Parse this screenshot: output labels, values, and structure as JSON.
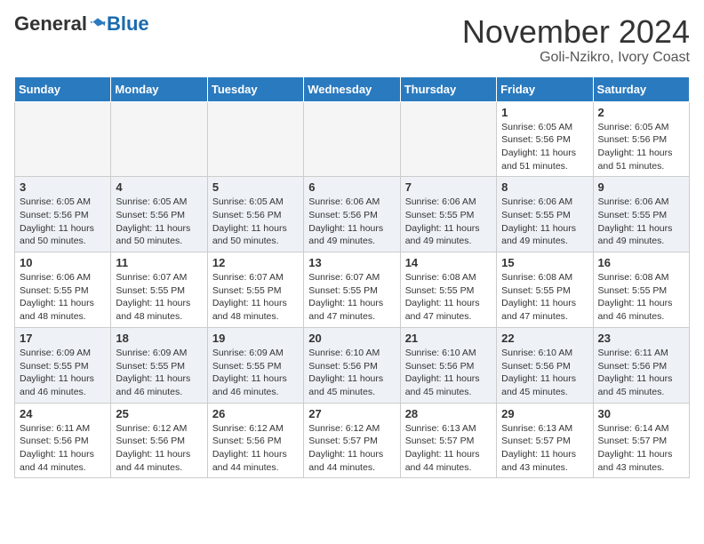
{
  "header": {
    "logo_general": "General",
    "logo_blue": "Blue",
    "month_title": "November 2024",
    "location": "Goli-Nzikro, Ivory Coast"
  },
  "calendar": {
    "days_of_week": [
      "Sunday",
      "Monday",
      "Tuesday",
      "Wednesday",
      "Thursday",
      "Friday",
      "Saturday"
    ],
    "weeks": [
      [
        {
          "day": "",
          "empty": true
        },
        {
          "day": "",
          "empty": true
        },
        {
          "day": "",
          "empty": true
        },
        {
          "day": "",
          "empty": true
        },
        {
          "day": "",
          "empty": true
        },
        {
          "day": "1",
          "sunrise": "Sunrise: 6:05 AM",
          "sunset": "Sunset: 5:56 PM",
          "daylight": "Daylight: 11 hours and 51 minutes."
        },
        {
          "day": "2",
          "sunrise": "Sunrise: 6:05 AM",
          "sunset": "Sunset: 5:56 PM",
          "daylight": "Daylight: 11 hours and 51 minutes."
        }
      ],
      [
        {
          "day": "3",
          "sunrise": "Sunrise: 6:05 AM",
          "sunset": "Sunset: 5:56 PM",
          "daylight": "Daylight: 11 hours and 50 minutes."
        },
        {
          "day": "4",
          "sunrise": "Sunrise: 6:05 AM",
          "sunset": "Sunset: 5:56 PM",
          "daylight": "Daylight: 11 hours and 50 minutes."
        },
        {
          "day": "5",
          "sunrise": "Sunrise: 6:05 AM",
          "sunset": "Sunset: 5:56 PM",
          "daylight": "Daylight: 11 hours and 50 minutes."
        },
        {
          "day": "6",
          "sunrise": "Sunrise: 6:06 AM",
          "sunset": "Sunset: 5:56 PM",
          "daylight": "Daylight: 11 hours and 49 minutes."
        },
        {
          "day": "7",
          "sunrise": "Sunrise: 6:06 AM",
          "sunset": "Sunset: 5:55 PM",
          "daylight": "Daylight: 11 hours and 49 minutes."
        },
        {
          "day": "8",
          "sunrise": "Sunrise: 6:06 AM",
          "sunset": "Sunset: 5:55 PM",
          "daylight": "Daylight: 11 hours and 49 minutes."
        },
        {
          "day": "9",
          "sunrise": "Sunrise: 6:06 AM",
          "sunset": "Sunset: 5:55 PM",
          "daylight": "Daylight: 11 hours and 49 minutes."
        }
      ],
      [
        {
          "day": "10",
          "sunrise": "Sunrise: 6:06 AM",
          "sunset": "Sunset: 5:55 PM",
          "daylight": "Daylight: 11 hours and 48 minutes."
        },
        {
          "day": "11",
          "sunrise": "Sunrise: 6:07 AM",
          "sunset": "Sunset: 5:55 PM",
          "daylight": "Daylight: 11 hours and 48 minutes."
        },
        {
          "day": "12",
          "sunrise": "Sunrise: 6:07 AM",
          "sunset": "Sunset: 5:55 PM",
          "daylight": "Daylight: 11 hours and 48 minutes."
        },
        {
          "day": "13",
          "sunrise": "Sunrise: 6:07 AM",
          "sunset": "Sunset: 5:55 PM",
          "daylight": "Daylight: 11 hours and 47 minutes."
        },
        {
          "day": "14",
          "sunrise": "Sunrise: 6:08 AM",
          "sunset": "Sunset: 5:55 PM",
          "daylight": "Daylight: 11 hours and 47 minutes."
        },
        {
          "day": "15",
          "sunrise": "Sunrise: 6:08 AM",
          "sunset": "Sunset: 5:55 PM",
          "daylight": "Daylight: 11 hours and 47 minutes."
        },
        {
          "day": "16",
          "sunrise": "Sunrise: 6:08 AM",
          "sunset": "Sunset: 5:55 PM",
          "daylight": "Daylight: 11 hours and 46 minutes."
        }
      ],
      [
        {
          "day": "17",
          "sunrise": "Sunrise: 6:09 AM",
          "sunset": "Sunset: 5:55 PM",
          "daylight": "Daylight: 11 hours and 46 minutes."
        },
        {
          "day": "18",
          "sunrise": "Sunrise: 6:09 AM",
          "sunset": "Sunset: 5:55 PM",
          "daylight": "Daylight: 11 hours and 46 minutes."
        },
        {
          "day": "19",
          "sunrise": "Sunrise: 6:09 AM",
          "sunset": "Sunset: 5:55 PM",
          "daylight": "Daylight: 11 hours and 46 minutes."
        },
        {
          "day": "20",
          "sunrise": "Sunrise: 6:10 AM",
          "sunset": "Sunset: 5:56 PM",
          "daylight": "Daylight: 11 hours and 45 minutes."
        },
        {
          "day": "21",
          "sunrise": "Sunrise: 6:10 AM",
          "sunset": "Sunset: 5:56 PM",
          "daylight": "Daylight: 11 hours and 45 minutes."
        },
        {
          "day": "22",
          "sunrise": "Sunrise: 6:10 AM",
          "sunset": "Sunset: 5:56 PM",
          "daylight": "Daylight: 11 hours and 45 minutes."
        },
        {
          "day": "23",
          "sunrise": "Sunrise: 6:11 AM",
          "sunset": "Sunset: 5:56 PM",
          "daylight": "Daylight: 11 hours and 45 minutes."
        }
      ],
      [
        {
          "day": "24",
          "sunrise": "Sunrise: 6:11 AM",
          "sunset": "Sunset: 5:56 PM",
          "daylight": "Daylight: 11 hours and 44 minutes."
        },
        {
          "day": "25",
          "sunrise": "Sunrise: 6:12 AM",
          "sunset": "Sunset: 5:56 PM",
          "daylight": "Daylight: 11 hours and 44 minutes."
        },
        {
          "day": "26",
          "sunrise": "Sunrise: 6:12 AM",
          "sunset": "Sunset: 5:56 PM",
          "daylight": "Daylight: 11 hours and 44 minutes."
        },
        {
          "day": "27",
          "sunrise": "Sunrise: 6:12 AM",
          "sunset": "Sunset: 5:57 PM",
          "daylight": "Daylight: 11 hours and 44 minutes."
        },
        {
          "day": "28",
          "sunrise": "Sunrise: 6:13 AM",
          "sunset": "Sunset: 5:57 PM",
          "daylight": "Daylight: 11 hours and 44 minutes."
        },
        {
          "day": "29",
          "sunrise": "Sunrise: 6:13 AM",
          "sunset": "Sunset: 5:57 PM",
          "daylight": "Daylight: 11 hours and 43 minutes."
        },
        {
          "day": "30",
          "sunrise": "Sunrise: 6:14 AM",
          "sunset": "Sunset: 5:57 PM",
          "daylight": "Daylight: 11 hours and 43 minutes."
        }
      ]
    ]
  }
}
